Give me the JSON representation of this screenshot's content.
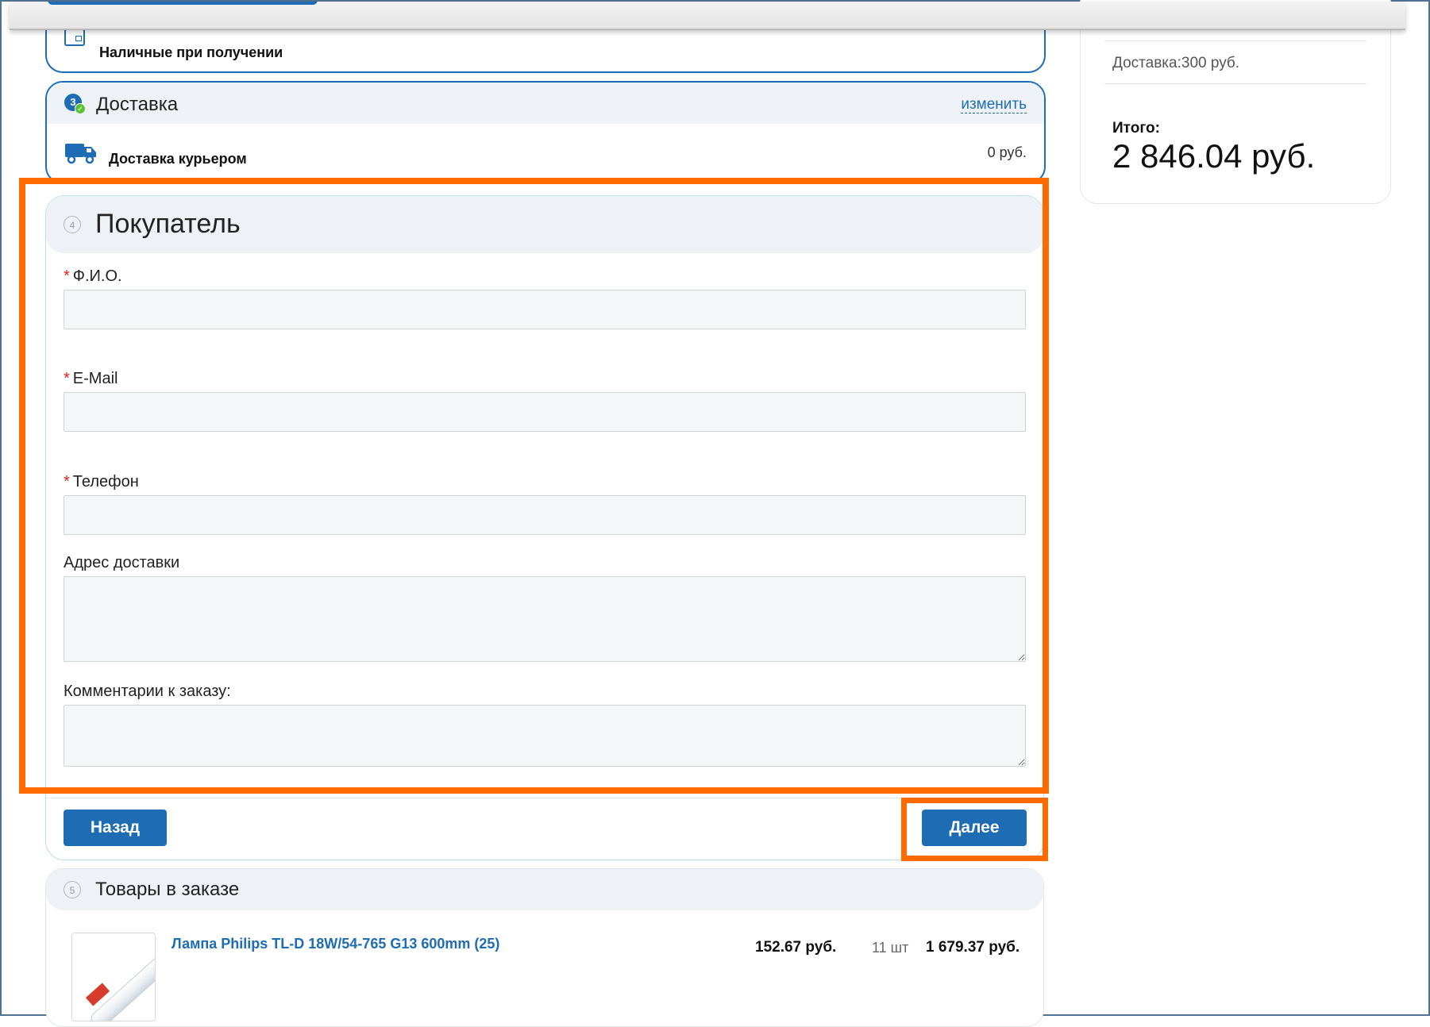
{
  "payment": {
    "method_label": "Наличные при получении"
  },
  "delivery": {
    "step_number": "3",
    "title": "Доставка",
    "change_link": "изменить",
    "method_label": "Доставка курьером",
    "price": "0 руб."
  },
  "buyer": {
    "step_number": "4",
    "title": "Покупатель",
    "fields": {
      "fio": {
        "label": "Ф.И.О.",
        "value": ""
      },
      "email": {
        "label": "E-Mail",
        "value": ""
      },
      "phone": {
        "label": "Телефон",
        "value": ""
      },
      "address": {
        "label": "Адрес доставки",
        "value": ""
      },
      "comment": {
        "label": "Комментарии к заказу:",
        "value": ""
      }
    },
    "required_mark": "*",
    "back_button": "Назад",
    "next_button": "Далее"
  },
  "goods": {
    "step_number": "5",
    "title": "Товары в заказе",
    "items": [
      {
        "name": "Лампа Philips TL-D 18W/54-765 G13 600mm (25)",
        "price": "152.67 руб.",
        "qty": "11 шт",
        "total": "1 679.37 руб."
      }
    ]
  },
  "summary": {
    "delivery_line": "Доставка:300 руб.",
    "total_label": "Итого:",
    "total_value": "2 846.04 руб."
  },
  "colors": {
    "accent": "#1e6cb3",
    "highlight": "#ff6a00",
    "success": "#5cc23a",
    "required": "#e2231a"
  }
}
